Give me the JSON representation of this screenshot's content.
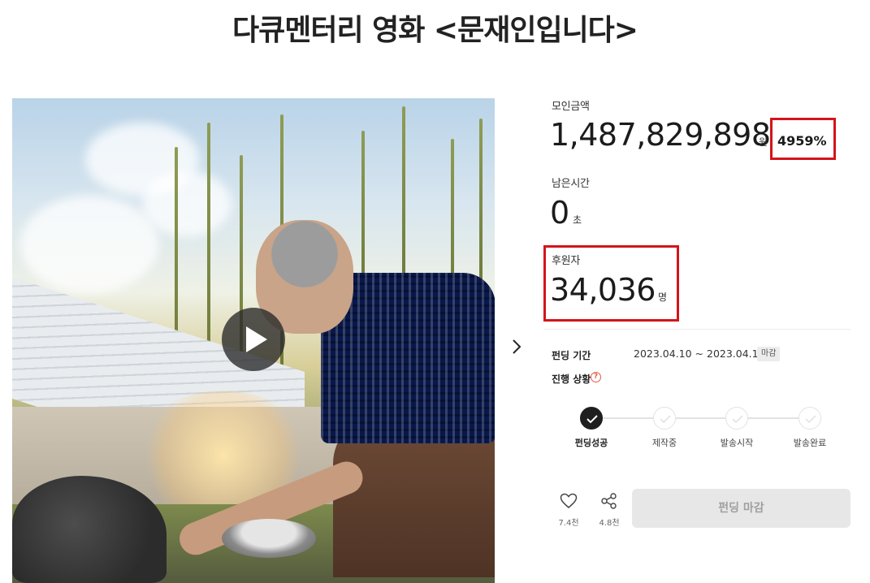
{
  "page": {
    "title": "다큐멘터리 영화 <문재인입니다>"
  },
  "stats": {
    "amount_label": "모인금액",
    "amount_value": "1,487,829,898",
    "amount_unit": "원",
    "percent": "4959%",
    "time_label": "남은시간",
    "time_value": "0",
    "time_unit": "초",
    "backers_label": "후원자",
    "backers_value": "34,036",
    "backers_unit": "명"
  },
  "info": {
    "period_label": "펀딩 기간",
    "period_value": "2023.04.10 ~ 2023.04.19",
    "closed_badge": "마감",
    "progress_label": "진행 상황",
    "help_icon": "?"
  },
  "steps": [
    {
      "label": "펀딩성공",
      "active": true
    },
    {
      "label": "제작중",
      "active": false
    },
    {
      "label": "발송시작",
      "active": false
    },
    {
      "label": "발송완료",
      "active": false
    }
  ],
  "actions": {
    "like_count": "7.4천",
    "share_count": "4.8천",
    "fund_button": "펀딩 마감"
  },
  "icons": [
    "play-icon",
    "chevron-right-icon",
    "heart-icon",
    "share-icon",
    "check-icon",
    "question-icon"
  ],
  "colors": {
    "highlight": "#d4141b",
    "active_step": "#1f1f1f",
    "button_disabled_bg": "#e7e7e7"
  }
}
